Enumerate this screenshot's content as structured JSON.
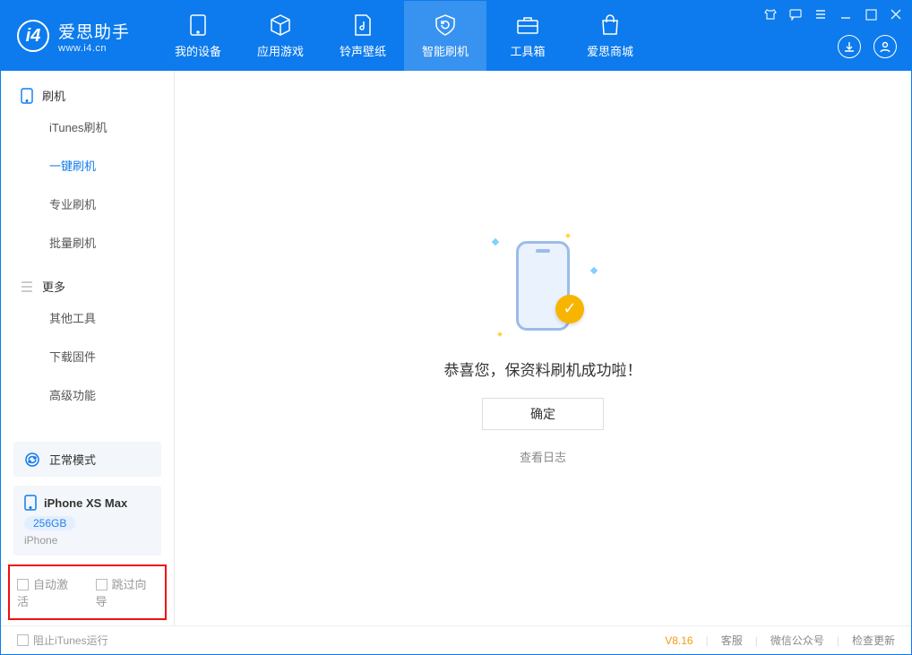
{
  "app": {
    "name": "爱思助手",
    "url": "www.i4.cn"
  },
  "tabs": [
    {
      "label": "我的设备"
    },
    {
      "label": "应用游戏"
    },
    {
      "label": "铃声壁纸"
    },
    {
      "label": "智能刷机"
    },
    {
      "label": "工具箱"
    },
    {
      "label": "爱思商城"
    }
  ],
  "sidebar": {
    "group1": "刷机",
    "items1": [
      "iTunes刷机",
      "一键刷机",
      "专业刷机",
      "批量刷机"
    ],
    "group2": "更多",
    "items2": [
      "其他工具",
      "下载固件",
      "高级功能"
    ]
  },
  "mode": {
    "label": "正常模式"
  },
  "device": {
    "name": "iPhone XS Max",
    "capacity": "256GB",
    "type": "iPhone"
  },
  "checks": {
    "auto_activate": "自动激活",
    "skip_guide": "跳过向导"
  },
  "main": {
    "success_msg": "恭喜您，保资料刷机成功啦！",
    "confirm": "确定",
    "view_log": "查看日志"
  },
  "footer": {
    "block_itunes": "阻止iTunes运行",
    "version": "V8.16",
    "support": "客服",
    "wechat": "微信公众号",
    "update": "检查更新"
  }
}
